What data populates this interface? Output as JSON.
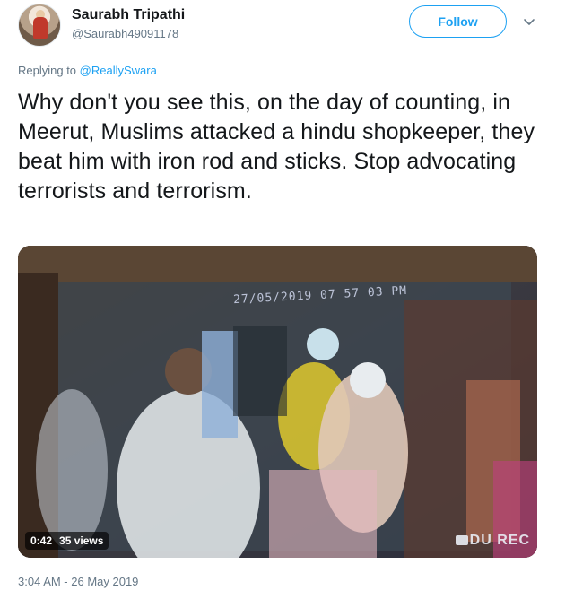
{
  "author": {
    "display_name": "Saurabh Tripathi",
    "handle": "@Saurabh49091178"
  },
  "follow_button": {
    "label": "Follow"
  },
  "more_icon": "chevron-down-icon",
  "reply": {
    "prefix": "Replying to ",
    "mention": "@ReallySwara"
  },
  "tweet": {
    "text": "Why don't you see this, on the day of counting, in Meerut, Muslims attacked a hindu shopkeeper, they beat him with iron rod and sticks. Stop advocating terrorists and terrorism."
  },
  "media": {
    "overlay_timestamp": "27/05/2019 07 57 03 PM",
    "watermark": "DU REC",
    "duration": "0:42",
    "views": "35 views"
  },
  "timestamp": "3:04 AM - 26 May 2019",
  "colors": {
    "accent": "#1da1f2",
    "text": "#14171a",
    "secondary": "#657786"
  }
}
